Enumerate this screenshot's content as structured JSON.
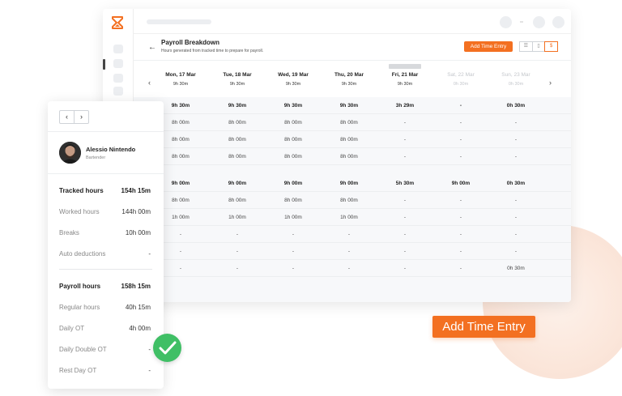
{
  "page": {
    "title": "Payroll Breakdown",
    "subtitle": "Hours generated from tracked time to prepare for payroll.",
    "add_entry_label": "Add Time Entry",
    "view_toggles": [
      "☰",
      "▯",
      "$"
    ]
  },
  "days": [
    {
      "label": "Mon, 17 Mar",
      "hours": "9h 30m"
    },
    {
      "label": "Tue, 18 Mar",
      "hours": "9h 30m"
    },
    {
      "label": "Wed, 19 Mar",
      "hours": "9h 30m"
    },
    {
      "label": "Thu, 20 Mar",
      "hours": "9h 30m"
    },
    {
      "label": "Fri, 21 Mar",
      "hours": "9h 30m"
    },
    {
      "label": "Sat, 22 Mar",
      "hours": "0h 30m"
    },
    {
      "label": "Sun, 23 Mar",
      "hours": "0h 30m"
    }
  ],
  "grid": {
    "rows": [
      [
        "9h 30m",
        "9h 30m",
        "9h 30m",
        "9h 30m",
        "3h 29m",
        "-",
        "0h 30m"
      ],
      [
        "8h 00m",
        "8h 00m",
        "8h 00m",
        "8h 00m",
        "-",
        "-",
        "-"
      ],
      [
        "8h 00m",
        "8h 00m",
        "8h 00m",
        "8h 00m",
        "-",
        "-",
        "-"
      ],
      [
        "8h 00m",
        "8h 00m",
        "8h 00m",
        "8h 00m",
        "-",
        "-",
        "-"
      ],
      [
        "9h 00m",
        "9h 00m",
        "9h 00m",
        "9h 00m",
        "5h 30m",
        "9h 00m",
        "0h 30m"
      ],
      [
        "8h 00m",
        "8h 00m",
        "8h 00m",
        "8h 00m",
        "-",
        "-",
        "-"
      ],
      [
        "1h 00m",
        "1h 00m",
        "1h 00m",
        "1h 00m",
        "-",
        "-",
        "-"
      ],
      [
        "-",
        "-",
        "-",
        "-",
        "-",
        "-",
        "-"
      ],
      [
        "-",
        "-",
        "-",
        "-",
        "-",
        "-",
        "-"
      ],
      [
        "-",
        "-",
        "-",
        "-",
        "-",
        "-",
        "0h 30m"
      ]
    ]
  },
  "employee": {
    "name": "Alessio Nintendo",
    "role": "Bartender",
    "stats": [
      {
        "label": "Tracked hours",
        "value": "154h 15m"
      },
      {
        "label": "Worked hours",
        "value": "144h 00m"
      },
      {
        "label": "Breaks",
        "value": "10h 00m"
      },
      {
        "label": "Auto deductions",
        "value": "-"
      },
      {
        "label": "Payroll hours",
        "value": "158h 15m"
      },
      {
        "label": "Regular hours",
        "value": "40h 15m"
      },
      {
        "label": "Daily OT",
        "value": "4h 00m"
      },
      {
        "label": "Daily Double OT",
        "value": "-"
      },
      {
        "label": "Rest Day OT",
        "value": "-"
      }
    ]
  },
  "colors": {
    "accent": "#f37021",
    "success": "#3fbf65"
  }
}
